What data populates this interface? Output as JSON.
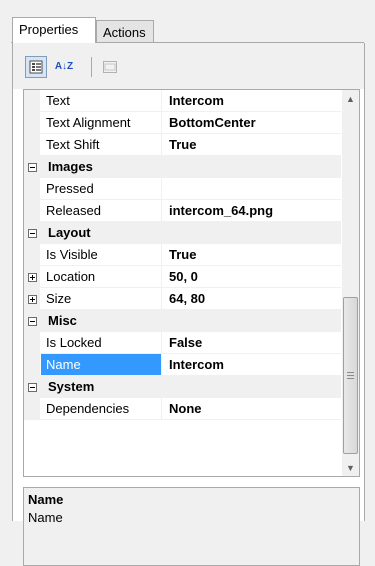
{
  "tabs": [
    {
      "label": "Properties",
      "active": true
    },
    {
      "label": "Actions",
      "active": false
    }
  ],
  "toolbar": {
    "categorized_icon": "categorized-view-icon",
    "alphabetical_icon": "alphabetical-sort-icon",
    "alphabetical_glyph": "A↓Z",
    "property_pages_icon": "property-pages-icon"
  },
  "grid": {
    "rows": [
      {
        "kind": "prop",
        "name": "Text",
        "value": "Intercom"
      },
      {
        "kind": "prop",
        "name": "Text Alignment",
        "value": "BottomCenter"
      },
      {
        "kind": "prop",
        "name": "Text Shift",
        "value": "True"
      },
      {
        "kind": "category",
        "name": "Images",
        "expanded": true
      },
      {
        "kind": "prop",
        "name": "Pressed",
        "value": ""
      },
      {
        "kind": "prop",
        "name": "Released",
        "value": "intercom_64.png"
      },
      {
        "kind": "category",
        "name": "Layout",
        "expanded": true
      },
      {
        "kind": "prop",
        "name": "Is Visible",
        "value": "True"
      },
      {
        "kind": "prop",
        "name": "Location",
        "value": "50, 0",
        "expandable": true
      },
      {
        "kind": "prop",
        "name": "Size",
        "value": "64, 80",
        "expandable": true
      },
      {
        "kind": "category",
        "name": "Misc",
        "expanded": true
      },
      {
        "kind": "prop",
        "name": "Is Locked",
        "value": "False"
      },
      {
        "kind": "prop",
        "name": "Name",
        "value": "Intercom",
        "selected": true
      },
      {
        "kind": "category",
        "name": "System",
        "expanded": true
      },
      {
        "kind": "prop",
        "name": "Dependencies",
        "value": "None"
      }
    ]
  },
  "scrollbar": {
    "up_glyph": "▲",
    "down_glyph": "▼"
  },
  "description": {
    "title": "Name",
    "text": "Name"
  },
  "colors": {
    "selection": "#3399ff",
    "chrome": "#f0f0f0",
    "border": "#a9a9a9"
  }
}
